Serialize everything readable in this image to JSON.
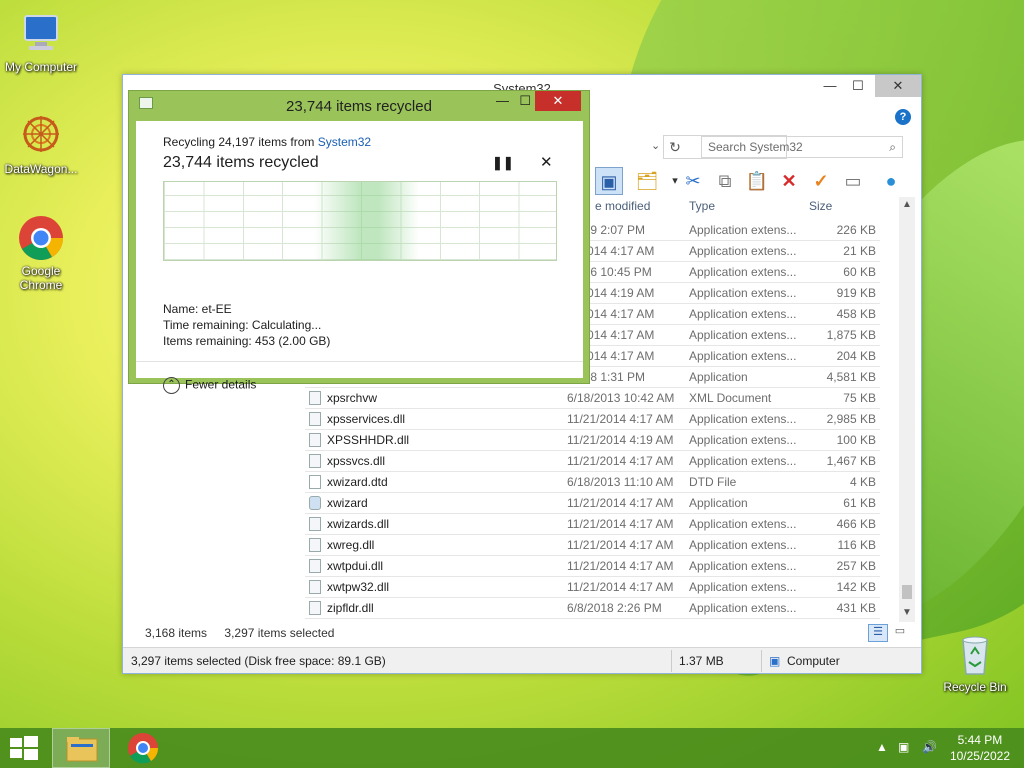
{
  "desktop": {
    "icons": [
      {
        "label": "My Computer"
      },
      {
        "label": "DataWagon..."
      },
      {
        "label": "Google Chrome"
      },
      {
        "label": "Recycle Bin"
      }
    ]
  },
  "explorer": {
    "title": "System32",
    "search_placeholder": "Search System32",
    "columns": {
      "date": "e modified",
      "type": "Type",
      "size": "Size"
    },
    "rows": [
      {
        "name": "",
        "date": "/2019 2:07 PM",
        "type": "Application extens...",
        "size": "226 KB"
      },
      {
        "name": "",
        "date": "/1/2014 4:17 AM",
        "type": "Application extens...",
        "size": "21 KB"
      },
      {
        "name": "",
        "date": "/2016 10:45 PM",
        "type": "Application extens...",
        "size": "60 KB"
      },
      {
        "name": "",
        "date": "/1/2014 4:19 AM",
        "type": "Application extens...",
        "size": "919 KB"
      },
      {
        "name": "",
        "date": "/1/2014 4:17 AM",
        "type": "Application extens...",
        "size": "458 KB"
      },
      {
        "name": "",
        "date": "/1/2014 4:17 AM",
        "type": "Application extens...",
        "size": "1,875 KB"
      },
      {
        "name": "",
        "date": "/1/2014 4:17 AM",
        "type": "Application extens...",
        "size": "204 KB"
      },
      {
        "name": "",
        "date": "/2018 1:31 PM",
        "type": "Application",
        "size": "4,581 KB"
      },
      {
        "name": "xpsrchvw",
        "date": "6/18/2013 10:42 AM",
        "type": "XML Document",
        "size": "75 KB"
      },
      {
        "name": "xpsservices.dll",
        "date": "11/21/2014 4:17 AM",
        "type": "Application extens...",
        "size": "2,985 KB"
      },
      {
        "name": "XPSSHHDR.dll",
        "date": "11/21/2014 4:19 AM",
        "type": "Application extens...",
        "size": "100 KB"
      },
      {
        "name": "xpssvcs.dll",
        "date": "11/21/2014 4:17 AM",
        "type": "Application extens...",
        "size": "1,467 KB"
      },
      {
        "name": "xwizard.dtd",
        "date": "6/18/2013 11:10 AM",
        "type": "DTD File",
        "size": "4 KB"
      },
      {
        "name": "xwizard",
        "date": "11/21/2014 4:17 AM",
        "type": "Application",
        "size": "61 KB"
      },
      {
        "name": "xwizards.dll",
        "date": "11/21/2014 4:17 AM",
        "type": "Application extens...",
        "size": "466 KB"
      },
      {
        "name": "xwreg.dll",
        "date": "11/21/2014 4:17 AM",
        "type": "Application extens...",
        "size": "116 KB"
      },
      {
        "name": "xwtpdui.dll",
        "date": "11/21/2014 4:17 AM",
        "type": "Application extens...",
        "size": "257 KB"
      },
      {
        "name": "xwtpw32.dll",
        "date": "11/21/2014 4:17 AM",
        "type": "Application extens...",
        "size": "142 KB"
      },
      {
        "name": "zipfldr.dll",
        "date": "6/8/2018 2:26 PM",
        "type": "Application extens...",
        "size": "431 KB"
      }
    ],
    "item_count": "3,168 items",
    "selected_count": "3,297 items selected",
    "status_selected": "3,297 items selected (Disk free space: 89.1 GB)",
    "status_size": "1.37 MB",
    "status_location": "Computer"
  },
  "dialog": {
    "title": "23,744 items recycled",
    "recycling_prefix": "Recycling 24,197 items from",
    "source_link": "System32",
    "headline": "23,744 items recycled",
    "name_line": "Name:  et-EE",
    "time_line": "Time remaining:  Calculating...",
    "items_line": "Items remaining:  453 (2.00 GB)",
    "fewer_details": "Fewer details"
  },
  "taskbar": {
    "time": "5:44 PM",
    "date": "10/25/2022"
  }
}
